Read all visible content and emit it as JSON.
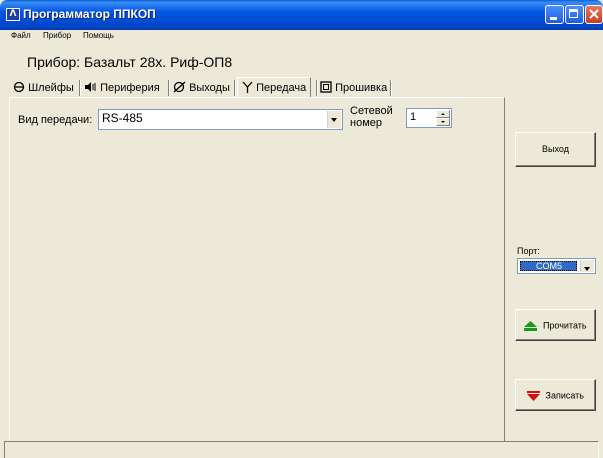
{
  "window": {
    "title": "Программатор ППКОП",
    "app_icon": "ППКОП",
    "controls": [
      "minimize-icon",
      "maximize-icon",
      "close-icon"
    ]
  },
  "menu": {
    "items": [
      "Файл",
      "Прибор",
      "Помощь"
    ]
  },
  "device_title": "Прибор: Базальт 28х. Риф-ОП8",
  "tabs": [
    {
      "label": "Шлейфы",
      "icon": "loop-icon",
      "active": false
    },
    {
      "label": "Периферия",
      "icon": "speaker-icon",
      "active": false
    },
    {
      "label": "Выходы",
      "icon": "output-icon",
      "active": false
    },
    {
      "label": "Передача",
      "icon": "antenna-icon",
      "active": true
    },
    {
      "label": "Прошивка",
      "icon": "chip-icon",
      "active": false
    }
  ],
  "transmission": {
    "type_label": "Вид передачи:",
    "type_value": "RS-485",
    "network_label_1": "Сетевой",
    "network_label_2": "номер",
    "network_value": "1"
  },
  "side": {
    "exit_label": "Выход",
    "port_label": "Порт:",
    "port_value": "COM5",
    "read_label": "Прочитать",
    "write_label": "Записать"
  },
  "colors": {
    "titlebar": "#0055e5",
    "window_bg": "#ece9d8",
    "read_icon": "#1a9a1a",
    "write_icon": "#d01010",
    "port_highlight": "#316ac5"
  }
}
